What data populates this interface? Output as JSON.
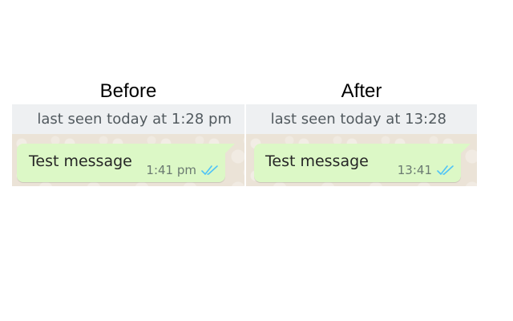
{
  "comparison": {
    "before": {
      "heading": "Before",
      "last_seen": "last seen today at 1:28 pm",
      "message": {
        "text": "Test message",
        "time": "1:41 pm",
        "status_icon": "double-check-read-icon"
      }
    },
    "after": {
      "heading": "After",
      "last_seen": "last seen today at 13:28",
      "message": {
        "text": "Test message",
        "time": "13:41",
        "status_icon": "double-check-read-icon"
      }
    }
  },
  "colors": {
    "bubble_outgoing": "#dcf8c6",
    "header_bar": "#eef0f2",
    "chat_background": "#ebe3d7",
    "read_receipt": "#4fc3f7"
  }
}
